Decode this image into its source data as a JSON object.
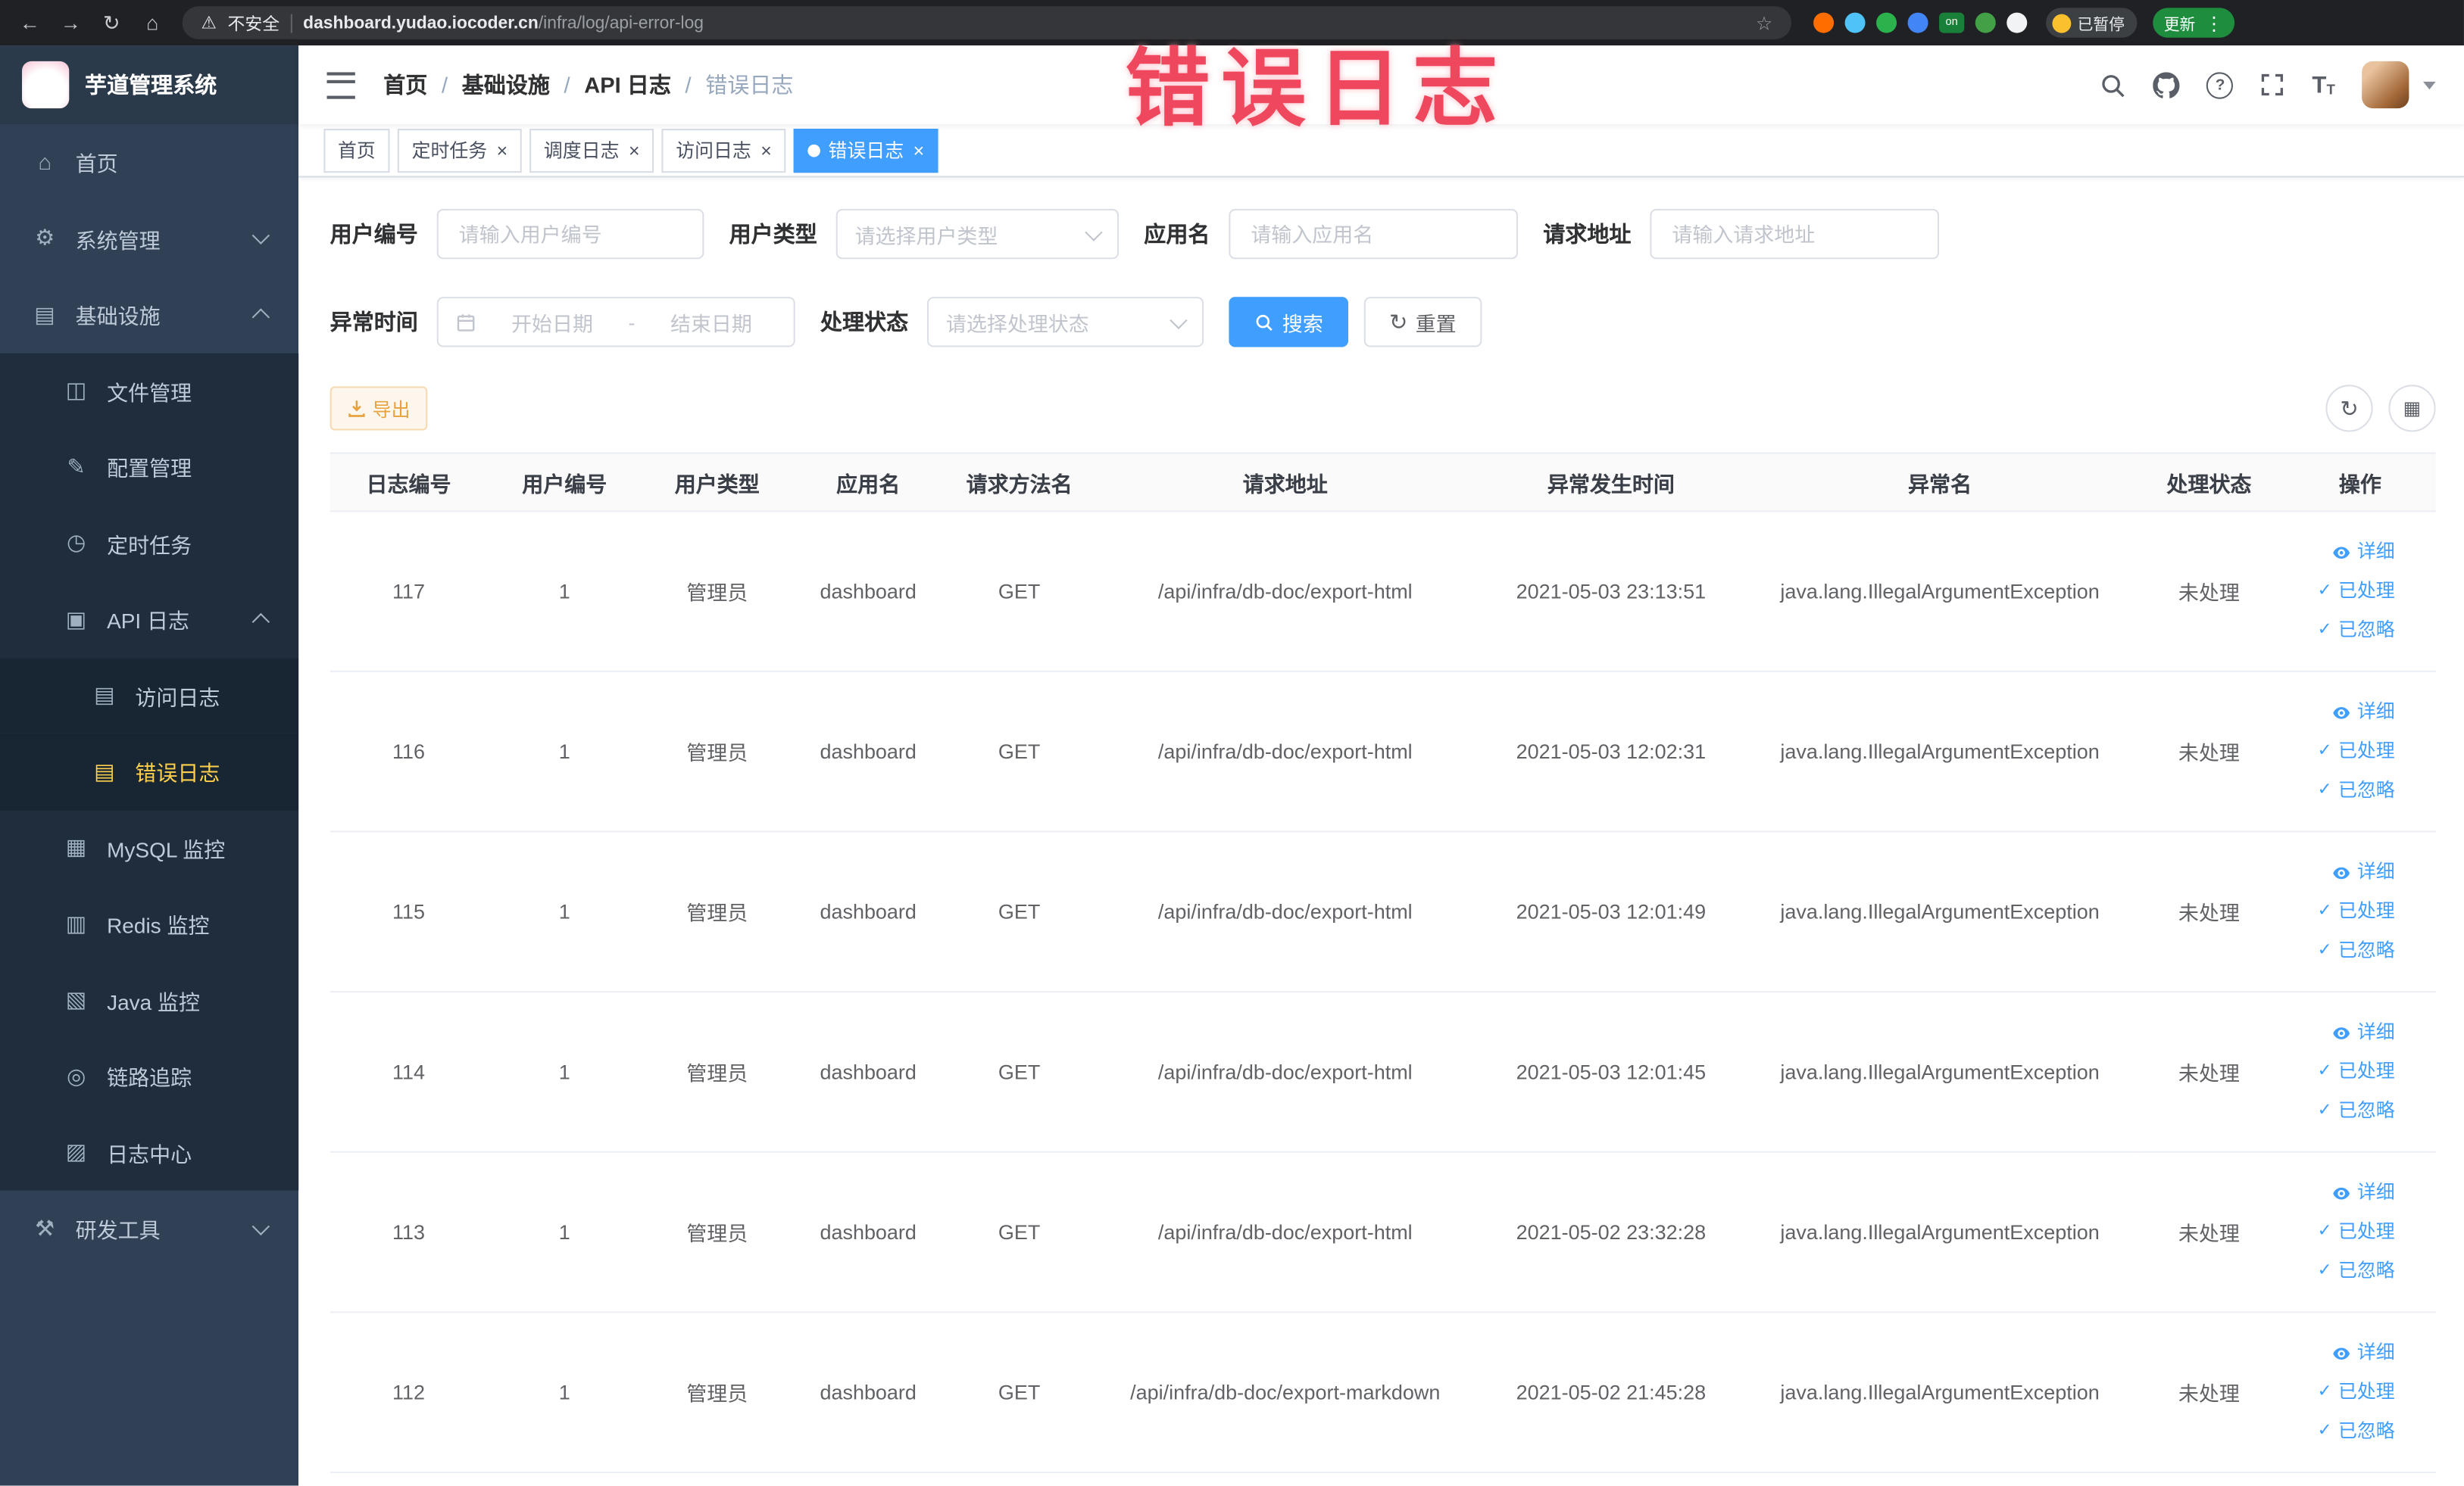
{
  "colors": {
    "accent": "#409eff",
    "warning": "#e6a23c",
    "sidebar_active_text": "#ffd04b",
    "tag_active_bg": "#409eff",
    "overlay_text_color": "#ef475d",
    "sidebar_bg": "#304156",
    "submenu_bg": "#1f2d3d"
  },
  "browser": {
    "security_label": "不安全",
    "url_domain": "dashboard.yudao.iocoder.cn",
    "url_path": "/infra/log/api-error-log",
    "paused_badge": "已暂停",
    "update_button": "更新"
  },
  "overlay_text": "错误日志",
  "sidebar": {
    "title": "芋道管理系统",
    "items": [
      {
        "name": "home",
        "icon": "home-icon",
        "label": "首页",
        "level": 1
      },
      {
        "name": "system-mgmt",
        "icon": "gear-icon",
        "label": "系统管理",
        "level": 1,
        "chevron": "down"
      },
      {
        "name": "infrastructure",
        "icon": "monitor-icon",
        "label": "基础设施",
        "level": 1,
        "chevron": "up"
      },
      {
        "name": "file-mgmt",
        "icon": "folder-icon",
        "label": "文件管理",
        "level": 2
      },
      {
        "name": "config-mgmt",
        "icon": "edit-icon",
        "label": "配置管理",
        "level": 2
      },
      {
        "name": "cron-job",
        "icon": "timer-icon",
        "label": "定时任务",
        "level": 2
      },
      {
        "name": "api-log",
        "icon": "log-icon",
        "label": "API 日志",
        "level": 2,
        "chevron": "up"
      },
      {
        "name": "access-log",
        "icon": "doc-icon",
        "label": "访问日志",
        "level": 3
      },
      {
        "name": "error-log",
        "icon": "doc-icon",
        "label": "错误日志",
        "level": 3,
        "active": true
      },
      {
        "name": "mysql-monitor",
        "icon": "mysql-icon",
        "label": "MySQL 监控",
        "level": 2
      },
      {
        "name": "redis-monitor",
        "icon": "redis-icon",
        "label": "Redis 监控",
        "level": 2
      },
      {
        "name": "java-monitor",
        "icon": "java-icon",
        "label": "Java 监控",
        "level": 2
      },
      {
        "name": "tracing",
        "icon": "trace-icon",
        "label": "链路追踪",
        "level": 2
      },
      {
        "name": "log-center",
        "icon": "logcenter-icon",
        "label": "日志中心",
        "level": 2
      },
      {
        "name": "dev-tools",
        "icon": "tools-icon",
        "label": "研发工具",
        "level": 1,
        "chevron": "down"
      }
    ]
  },
  "navbar": {
    "breadcrumb": [
      "首页",
      "基础设施",
      "API 日志",
      "错误日志"
    ]
  },
  "tabs": [
    {
      "name": "tab-home",
      "label": "首页",
      "closable": false,
      "active": false
    },
    {
      "name": "tab-cron-job",
      "label": "定时任务",
      "closable": true,
      "active": false
    },
    {
      "name": "tab-job-log",
      "label": "调度日志",
      "closable": true,
      "active": false
    },
    {
      "name": "tab-access-log",
      "label": "访问日志",
      "closable": true,
      "active": false
    },
    {
      "name": "tab-error-log",
      "label": "错误日志",
      "closable": true,
      "active": true
    }
  ],
  "filters": {
    "user_id": {
      "label": "用户编号",
      "placeholder": "请输入用户编号"
    },
    "user_type": {
      "label": "用户类型",
      "placeholder": "请选择用户类型"
    },
    "app_name": {
      "label": "应用名",
      "placeholder": "请输入应用名"
    },
    "request_url": {
      "label": "请求地址",
      "placeholder": "请输入请求地址"
    },
    "exception_time": {
      "label": "异常时间",
      "start_placeholder": "开始日期",
      "separator": "-",
      "end_placeholder": "结束日期"
    },
    "process_status": {
      "label": "处理状态",
      "placeholder": "请选择处理状态"
    },
    "search_button": "搜索",
    "reset_button": "重置"
  },
  "toolbar": {
    "export_button": "导出"
  },
  "table": {
    "columns": [
      "日志编号",
      "用户编号",
      "用户类型",
      "应用名",
      "请求方法名",
      "请求地址",
      "异常发生时间",
      "异常名",
      "处理状态",
      "操作"
    ],
    "actions": [
      "详细",
      "已处理",
      "已忽略"
    ],
    "rows": [
      {
        "log_id": "117",
        "user_id": "1",
        "user_type": "管理员",
        "app_name": "dashboard",
        "method": "GET",
        "request_url": "/api/infra/db-doc/export-html",
        "occurred_at": "2021-05-03 23:13:51",
        "exception": "java.lang.IllegalArgumentException",
        "status": "未处理"
      },
      {
        "log_id": "116",
        "user_id": "1",
        "user_type": "管理员",
        "app_name": "dashboard",
        "method": "GET",
        "request_url": "/api/infra/db-doc/export-html",
        "occurred_at": "2021-05-03 12:02:31",
        "exception": "java.lang.IllegalArgumentException",
        "status": "未处理"
      },
      {
        "log_id": "115",
        "user_id": "1",
        "user_type": "管理员",
        "app_name": "dashboard",
        "method": "GET",
        "request_url": "/api/infra/db-doc/export-html",
        "occurred_at": "2021-05-03 12:01:49",
        "exception": "java.lang.IllegalArgumentException",
        "status": "未处理"
      },
      {
        "log_id": "114",
        "user_id": "1",
        "user_type": "管理员",
        "app_name": "dashboard",
        "method": "GET",
        "request_url": "/api/infra/db-doc/export-html",
        "occurred_at": "2021-05-03 12:01:45",
        "exception": "java.lang.IllegalArgumentException",
        "status": "未处理"
      },
      {
        "log_id": "113",
        "user_id": "1",
        "user_type": "管理员",
        "app_name": "dashboard",
        "method": "GET",
        "request_url": "/api/infra/db-doc/export-html",
        "occurred_at": "2021-05-02 23:32:28",
        "exception": "java.lang.IllegalArgumentException",
        "status": "未处理"
      },
      {
        "log_id": "112",
        "user_id": "1",
        "user_type": "管理员",
        "app_name": "dashboard",
        "method": "GET",
        "request_url": "/api/infra/db-doc/export-markdown",
        "occurred_at": "2021-05-02 21:45:28",
        "exception": "java.lang.IllegalArgumentException",
        "status": "未处理"
      }
    ]
  }
}
